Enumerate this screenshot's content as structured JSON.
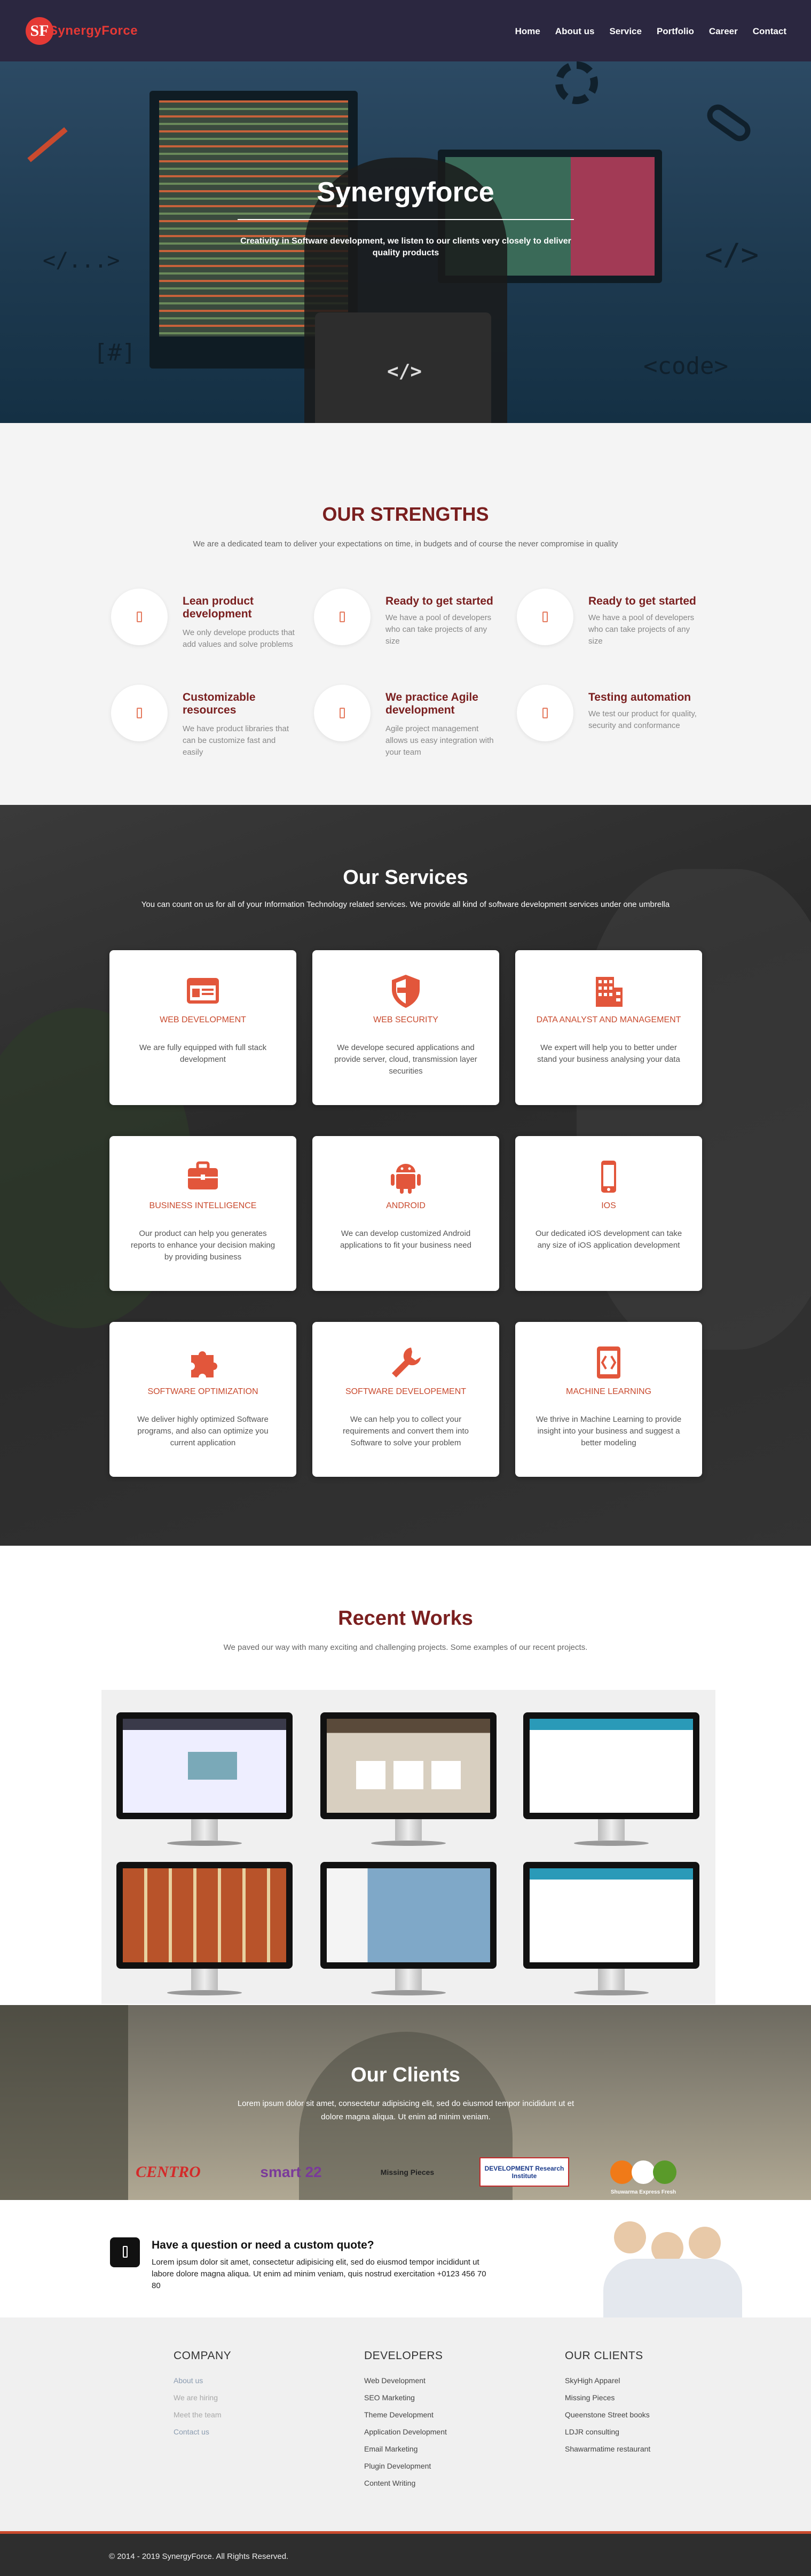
{
  "brand": {
    "name": "SynergyForce",
    "mark": "SF"
  },
  "nav": {
    "items": [
      "Home",
      "About us",
      "Service",
      "Portfolio",
      "Career",
      "Contact"
    ]
  },
  "hero": {
    "title": "Synergyforce",
    "subtitle": "Creativity in Software development, we listen to our clients very closely to deliver quality products",
    "code_glyphs": [
      "</...>",
      "</>",
      "[#]",
      "<code>",
      "</>"
    ]
  },
  "strengths": {
    "title": "OUR STRENGTHS",
    "lead": "We are a dedicated team to deliver your expectations on time, in budgets and of course the never compromise in quality",
    "items": [
      {
        "title": "Lean product development",
        "text": "We only develope products that add values and solve problems"
      },
      {
        "title": "Ready to get started",
        "text": "We have a pool of developers who can take projects of any size"
      },
      {
        "title": "Ready to get started",
        "text": "We have a pool of developers who can take projects of any size"
      },
      {
        "title": "Customizable resources",
        "text": "We have product libraries that can be customize fast and easily"
      },
      {
        "title": "We practice Agile development",
        "text": "Agile project management allows us easy integration with your team"
      },
      {
        "title": "Testing automation",
        "text": "We test our product for quality, security and conformance"
      }
    ]
  },
  "services": {
    "title": "Our Services",
    "lead": "You can count on us for all of your Information Technology related services. We provide all kind of software development services under one umbrella",
    "accent": "#e2563b",
    "items": [
      {
        "title": "WEB DEVELOPMENT",
        "icon": "browser-window-icon",
        "text": "We are fully equipped with full stack development"
      },
      {
        "title": "WEB SECURITY",
        "icon": "shield-icon",
        "text": "We develope secured applications and provide server, cloud, transmission layer securities"
      },
      {
        "title": "DATA ANALYST AND MANAGEMENT",
        "icon": "building-icon",
        "text": "We expert will help you to better under stand your business analysing your data"
      },
      {
        "title": "BUSINESS INTELLIGENCE",
        "icon": "briefcase-icon",
        "text": "Our product can help you generates reports to enhance your decision making by providing business"
      },
      {
        "title": "ANDROID",
        "icon": "android-icon",
        "text": "We can develop customized Android applications to fit your business need"
      },
      {
        "title": "IOS",
        "icon": "mobile-phone-icon",
        "text": "Our dedicated iOS development can take any size of iOS application development"
      },
      {
        "title": "SOFTWARE OPTIMIZATION",
        "icon": "puzzle-piece-icon",
        "text": "We deliver highly optimized Software programs, and also can optimize you current application"
      },
      {
        "title": "SOFTWARE DEVELOPEMENT",
        "icon": "wrench-icon",
        "text": "We can help you to collect your requirements and convert them into Software to solve your problem"
      },
      {
        "title": "MACHINE LEARNING",
        "icon": "code-file-icon",
        "text": "We thrive in Machine Learning to provide insight into your business and suggest a better modeling"
      }
    ]
  },
  "works": {
    "title": "Recent Works",
    "lead": "We paved our way with many exciting and challenging projects. Some examples of our recent projects."
  },
  "clients": {
    "title": "Our Clients",
    "lead": "Lorem ipsum dolor sit amet, consectetur adipisicing elit, sed do eiusmod tempor incididunt ut et dolore magna aliqua. Ut enim ad minim veniam.",
    "logos": [
      "CENTRO",
      "smart 22",
      "Missing Pieces",
      "DEVELOPMENT Research Institute",
      "Shuwarma Express Fresh"
    ]
  },
  "quote": {
    "title": "Have a question or need a custom quote?",
    "text": "Lorem ipsum dolor sit amet, consectetur adipisicing elit, sed do eiusmod tempor incididunt ut labore dolore magna aliqua. Ut enim ad minim veniam, quis nostrud exercitation +0123 456 70 80"
  },
  "footer": {
    "company": {
      "title": "COMPANY",
      "links": [
        "About us",
        "We are hiring",
        "Meet the team",
        "Contact us"
      ]
    },
    "developers": {
      "title": "DEVELOPERS",
      "links": [
        "Web Development",
        "SEO Marketing",
        "Theme Development",
        "Application Development",
        "Email Marketing",
        "Plugin Development",
        "Content Writing"
      ]
    },
    "our_clients": {
      "title": "OUR CLIENTS",
      "links": [
        "SkyHigh Apparel",
        "Missing Pieces",
        "Queenstone Street books",
        "LDJR consulting",
        "Shawarmatime restaurant"
      ]
    },
    "copyright": "© 2014 - 2019 SynergyForce. All Rights Reserved."
  }
}
